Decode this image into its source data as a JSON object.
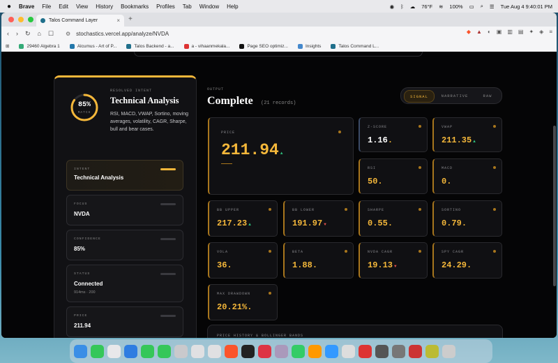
{
  "menubar": {
    "apple": "",
    "app": "Brave",
    "items": [
      "File",
      "Edit",
      "View",
      "History",
      "Bookmarks",
      "Profiles",
      "Tab",
      "Window",
      "Help"
    ],
    "weather": "76°F",
    "battery": "100%",
    "datetime": "Tue Aug 4  9:40:01 PM"
  },
  "browser": {
    "tab_title": "Talos Command Layer",
    "tab_close": "×",
    "new_tab": "+",
    "url": "stochastics.vercel.app/analyze/NVDA",
    "bookmarks": [
      "29460 Algebra 1",
      "Alcumus - Art of P...",
      "Talos Backend - a...",
      "a - vihaanmekala...",
      "Page SEO optimiz...",
      "Insights",
      "Talos Command L..."
    ]
  },
  "sidebar": {
    "match_pct": "85%",
    "match_label": "MATCH",
    "match_value": 0.85,
    "resolved_label": "RESOLVED INTENT",
    "title": "Technical Analysis",
    "description": "RSI, MACD, VWAP, Sortino, moving averages, volatility, CAGR, Sharpe, bull and bear cases.",
    "cards": [
      {
        "key": "INTENT",
        "value": "Technical Analysis",
        "sub": ""
      },
      {
        "key": "FOCUS",
        "value": "NVDA",
        "sub": ""
      },
      {
        "key": "CONFIDENCE",
        "value": "85%",
        "sub": ""
      },
      {
        "key": "STATUS",
        "value": "Connected",
        "sub": "914ms · 200"
      },
      {
        "key": "PRICE",
        "value": "211.94",
        "sub": ""
      }
    ]
  },
  "main": {
    "output_label": "OUTPUT",
    "title": "Complete",
    "records": "(21 records)",
    "modes": [
      "SIGNAL",
      "NARRATIVE",
      "RAW"
    ],
    "active_mode": "SIGNAL",
    "history_label": "PRICE HISTORY & BOLLINGER BANDS",
    "metrics": {
      "price": {
        "key": "PRICE",
        "value": "211.94",
        "trend": "▲"
      },
      "zscore": {
        "key": "Z-SCORE",
        "value": "1.16",
        "trend": ""
      },
      "vwap": {
        "key": "VWAP",
        "value": "211.35",
        "trend": "▲"
      },
      "rsi": {
        "key": "RSI",
        "value": "50",
        "trend": ""
      },
      "macd": {
        "key": "MACD",
        "value": "0",
        "trend": ""
      },
      "bb_upper": {
        "key": "BB UPPER",
        "value": "217.23",
        "trend": "▲"
      },
      "bb_lower": {
        "key": "BB LOWER",
        "value": "191.97",
        "trend": "▼"
      },
      "sharpe": {
        "key": "SHARPE",
        "value": "0.55",
        "trend": ""
      },
      "sortino": {
        "key": "SORTINO",
        "value": "0.79",
        "trend": ""
      },
      "vola": {
        "key": "VOLA",
        "value": "36",
        "trend": ""
      },
      "beta": {
        "key": "BETA",
        "value": "1.88",
        "trend": ""
      },
      "nvda_cagr": {
        "key": "NVDA CAGR",
        "value": "19.13",
        "trend": "▼"
      },
      "spy_cagr": {
        "key": "SPY CAGR",
        "value": "24.29",
        "trend": ""
      },
      "max_dd": {
        "key": "MAX DRAWDOWN",
        "value": "20.21%",
        "trend": ""
      }
    }
  },
  "colors": {
    "accent": "#f4b73a",
    "up": "#2ec27e",
    "down": "#e0504b",
    "bg": "#050506"
  }
}
